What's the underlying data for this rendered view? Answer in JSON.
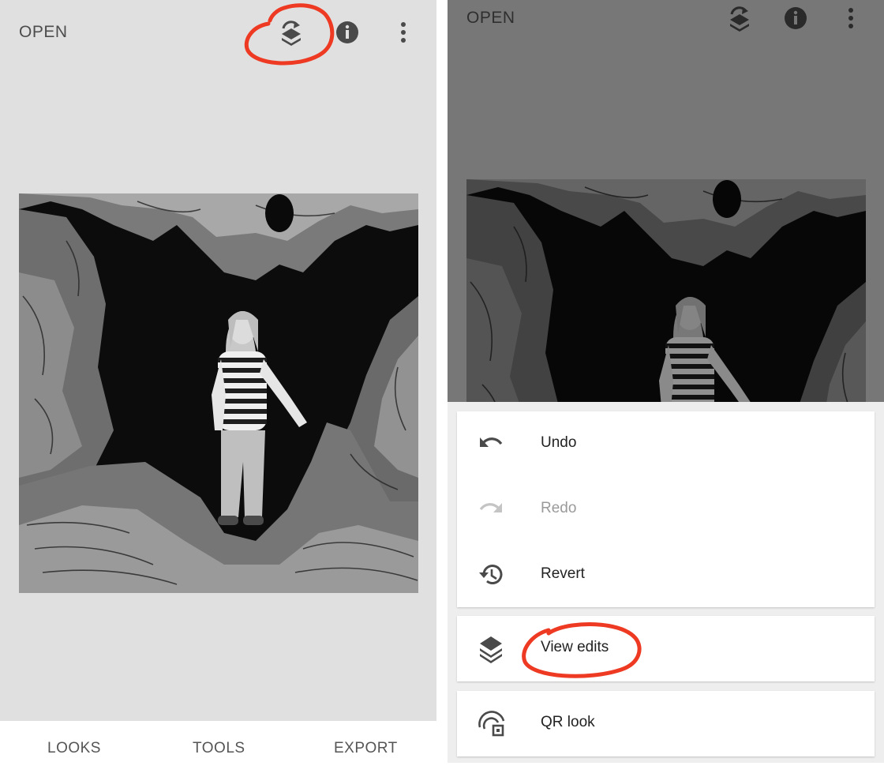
{
  "left_screen": {
    "toolbar": {
      "open_label": "OPEN",
      "icons": [
        "edit-stack-icon",
        "info-icon",
        "overflow-menu-icon"
      ]
    },
    "photo": {
      "description_icon": "photo"
    },
    "bottom_nav": {
      "tabs": [
        {
          "label": "LOOKS"
        },
        {
          "label": "TOOLS"
        },
        {
          "label": "EXPORT"
        }
      ]
    }
  },
  "right_screen": {
    "toolbar": {
      "open_label": "OPEN",
      "icons": [
        "edit-stack-icon",
        "info-icon",
        "overflow-menu-icon"
      ]
    },
    "menu": {
      "group1": [
        {
          "label": "Undo",
          "icon": "undo-icon",
          "enabled": true
        },
        {
          "label": "Redo",
          "icon": "redo-icon",
          "enabled": false
        },
        {
          "label": "Revert",
          "icon": "history-icon",
          "enabled": true
        }
      ],
      "view_edits": {
        "label": "View edits",
        "icon": "layers-icon"
      },
      "qr_look": {
        "label": "QR look",
        "icon": "qr-look-icon"
      }
    }
  },
  "colors": {
    "annotation": "#ee3a22",
    "left_bg": "#e0e0e0",
    "dimmed_bg": "#777777",
    "icon_dark": "#4a4a4a"
  }
}
